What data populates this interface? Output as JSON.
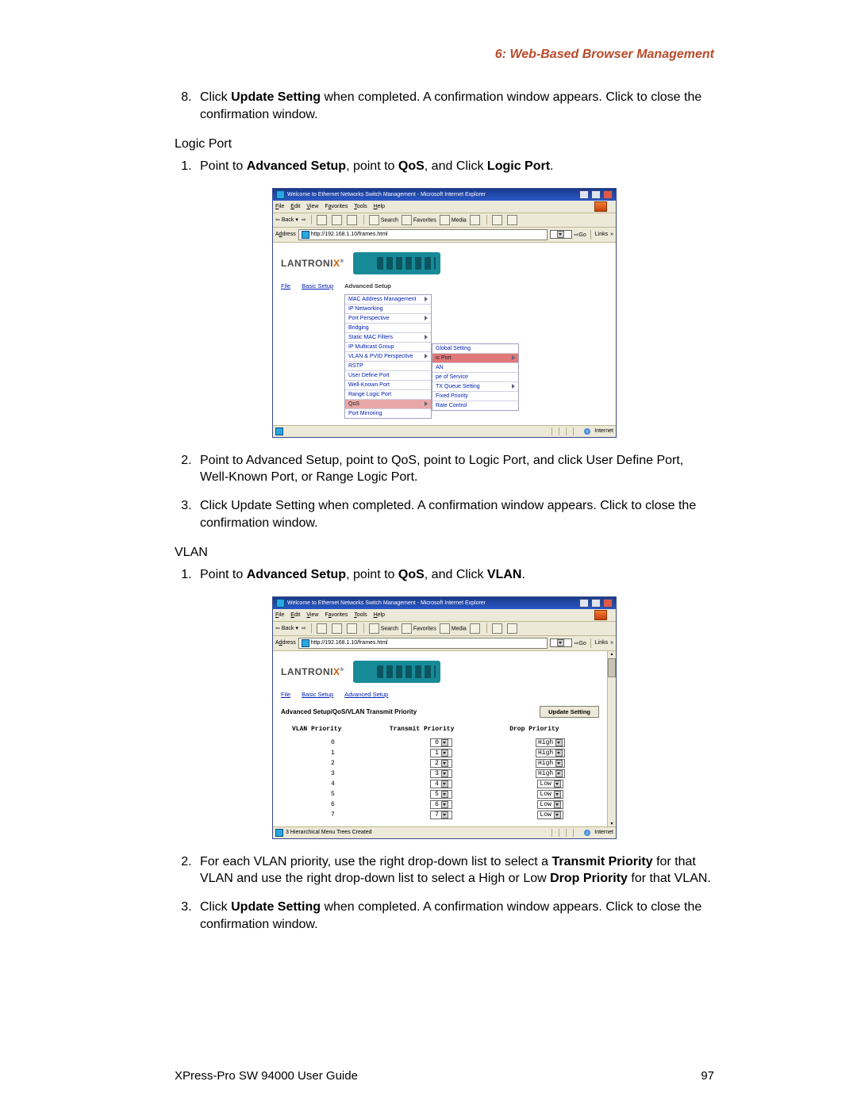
{
  "chapter": "6: Web-Based Browser Management",
  "step8": {
    "prefix": "Click ",
    "bold1": "Update Setting",
    "rest": " when completed. A confirmation window appears. Click to close the confirmation window."
  },
  "logic_port_heading": "Logic Port",
  "lp_step1": {
    "prefix": "Point to ",
    "b1": "Advanced Setup",
    "mid1": ", point to ",
    "b2": "QoS",
    "mid2": ", and Click ",
    "b3": "Logic Port",
    "end": "."
  },
  "lp_step2": "Point to Advanced Setup, point to QoS, point to Logic Port, and click User Define Port, Well-Known Port, or Range Logic Port.",
  "lp_step3": "Click Update Setting when completed. A confirmation window appears. Click to close the confirmation window.",
  "vlan_heading": "VLAN",
  "vlan_step1": {
    "prefix": "Point to ",
    "b1": "Advanced Setup",
    "mid1": ", point to ",
    "b2": "QoS",
    "mid2": ", and Click ",
    "b3": "VLAN",
    "end": "."
  },
  "vlan_step2": {
    "prefix": "For each VLAN priority, use the right drop-down list to select a ",
    "b1": "Transmit Priority",
    "mid1": " for that VLAN and use the right drop-down list to select a High or Low ",
    "b2": "Drop Priority",
    "mid2": " for that VLAN."
  },
  "vlan_step3": {
    "prefix": "Click ",
    "b1": "Update Setting",
    "rest": " when completed. A confirmation window appears. Click to close the confirmation window."
  },
  "footer_left": "XPress-Pro SW 94000 User Guide",
  "footer_right": "97",
  "ie": {
    "title": "Welcome to Ethernet Networks Switch Management - Microsoft Internet Explorer",
    "menu": {
      "file": "File",
      "edit": "Edit",
      "view": "View",
      "fav": "Favorites",
      "tools": "Tools",
      "help": "Help"
    },
    "toolbar": {
      "back": "Back",
      "search": "Search",
      "favorites": "Favorites",
      "media": "Media"
    },
    "addr_label": "Address",
    "addr_value": "http://192.168.1.10/frames.html",
    "go": "Go",
    "links": "Links",
    "status_internet": "Internet"
  },
  "brand": {
    "l": "LANTRONI",
    "x": "X"
  },
  "nav": {
    "file": "File",
    "basic": "Basic Setup",
    "advanced": "Advanced Setup"
  },
  "shot1": {
    "main_menu": [
      {
        "t": "MAC Address Management",
        "arrow": true
      },
      {
        "t": "IP Networking"
      },
      {
        "t": "Port Perspective",
        "arrow": true
      },
      {
        "t": "Bridging"
      },
      {
        "t": "Static MAC Filters",
        "arrow": true
      },
      {
        "t": "IP Multicast Group"
      },
      {
        "t": "VLAN & PVID Perspective",
        "arrow": true
      },
      {
        "t": "RSTP"
      },
      {
        "t": "User Define Port"
      },
      {
        "t": "Well-Known Port"
      },
      {
        "t": "Range Logic Port"
      },
      {
        "t": "QoS",
        "arrow": true,
        "hi": true
      },
      {
        "t": "Port Mirroring"
      }
    ],
    "sub_menu": [
      {
        "t": "Global Setting"
      },
      {
        "t": "ic Port",
        "arrow": true,
        "hi": true
      },
      {
        "t": "AN"
      },
      {
        "t": "pe of Service"
      },
      {
        "t": "TX Queue Setting",
        "arrow": true
      },
      {
        "t": "Fixed Priority"
      },
      {
        "t": "Rate Control"
      }
    ],
    "status_left": ""
  },
  "shot2": {
    "path": "Advanced Setup/QoS/VLAN Transmit Priority",
    "update_btn": "Update Setting",
    "headers": {
      "c1": "VLAN Priority",
      "c2": "Transmit Priority",
      "c3": "Drop Priority"
    },
    "rows": [
      {
        "p": "0",
        "t": "0",
        "d": "High"
      },
      {
        "p": "1",
        "t": "1",
        "d": "High"
      },
      {
        "p": "2",
        "t": "2",
        "d": "High"
      },
      {
        "p": "3",
        "t": "3",
        "d": "High"
      },
      {
        "p": "4",
        "t": "4",
        "d": "Low"
      },
      {
        "p": "5",
        "t": "5",
        "d": "Low"
      },
      {
        "p": "6",
        "t": "6",
        "d": "Low"
      },
      {
        "p": "7",
        "t": "7",
        "d": "Low"
      }
    ],
    "status_left": "3 Hierarchical Menu Trees Created"
  }
}
